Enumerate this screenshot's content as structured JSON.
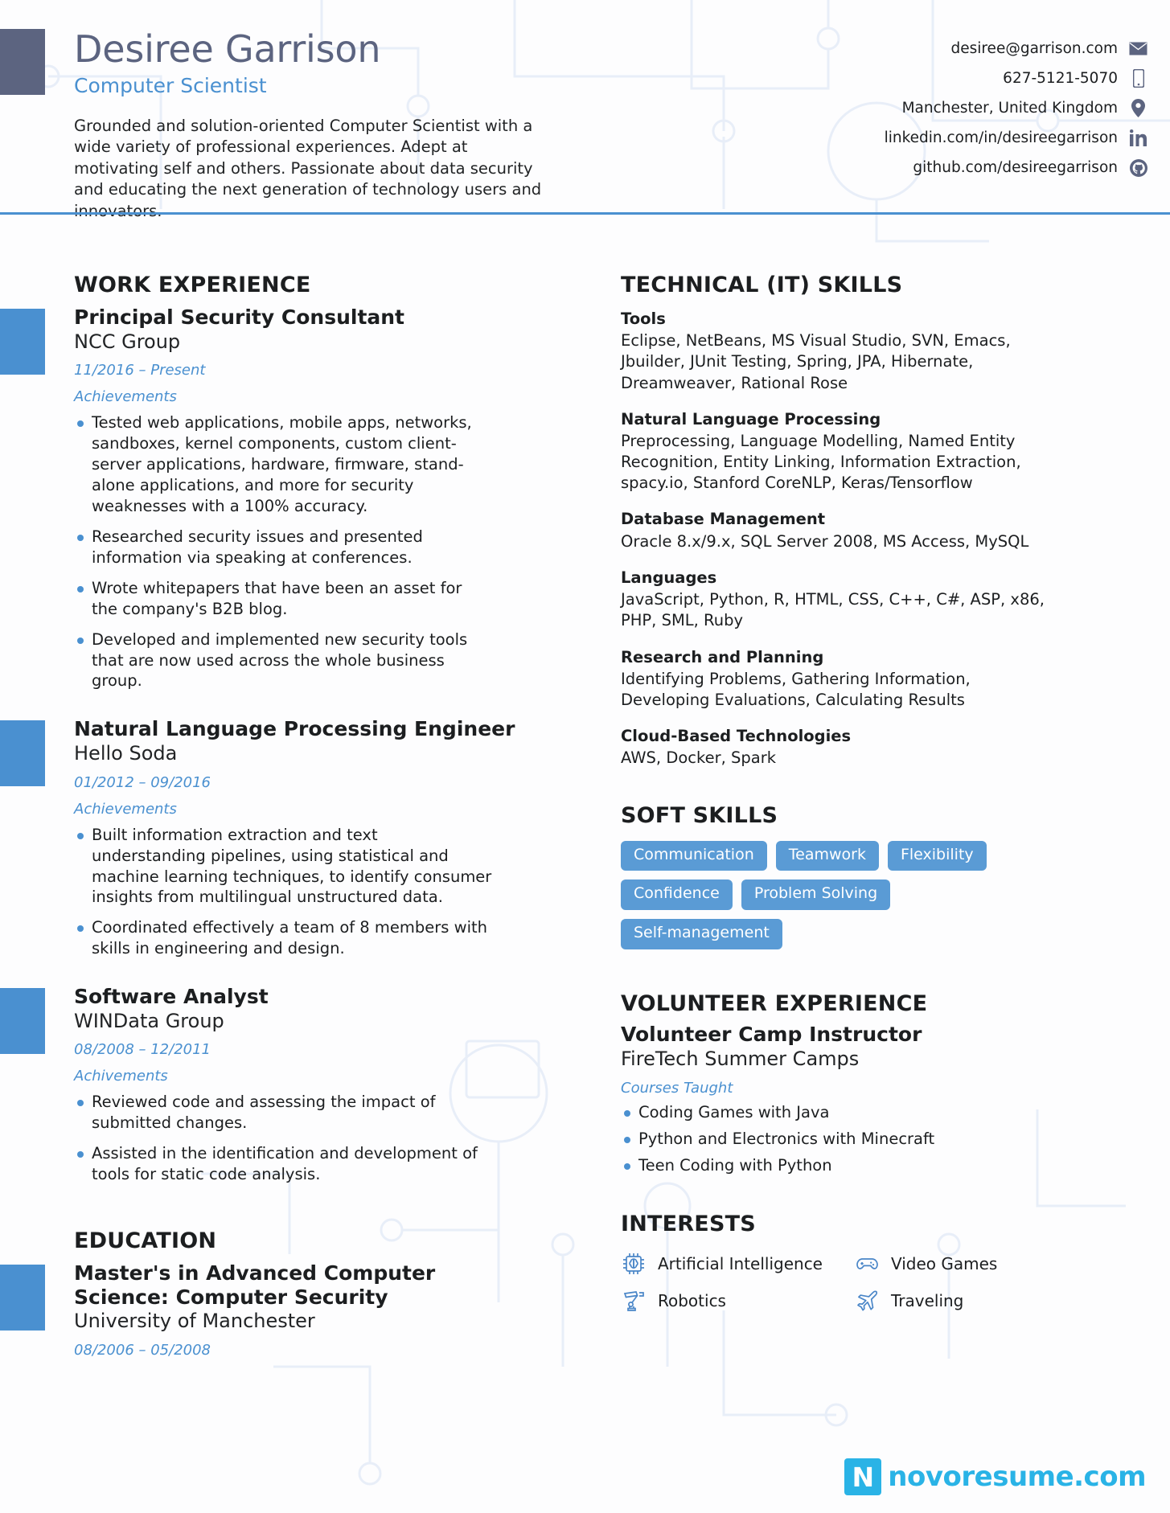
{
  "header": {
    "name": "Desiree Garrison",
    "title": "Computer Scientist",
    "summary": "Grounded and solution-oriented Computer Scientist with a wide variety of professional experiences. Adept at motivating self and others. Passionate about data security and educating the next generation of technology users and innovators.",
    "contacts": [
      {
        "text": "desiree@garrison.com",
        "icon": "envelope-icon"
      },
      {
        "text": "627-5121-5070",
        "icon": "mobile-phone-icon"
      },
      {
        "text": "Manchester, United Kingdom",
        "icon": "location-pin-icon"
      },
      {
        "text": "linkedin.com/in/desireegarrison",
        "icon": "linkedin-icon"
      },
      {
        "text": "github.com/desireegarrison",
        "icon": "github-icon"
      }
    ]
  },
  "work_experience": {
    "heading": "WORK EXPERIENCE",
    "jobs": [
      {
        "role": "Principal Security Consultant",
        "company": "NCC Group",
        "dates": "11/2016 – Present",
        "subhead": "Achievements",
        "bullets": [
          "Tested web applications, mobile apps, networks, sandboxes, kernel components, custom client-server applications, hardware, firmware, stand-alone applications, and more for security weaknesses with a 100% accuracy.",
          "Researched security issues and presented information via speaking at conferences.",
          "Wrote whitepapers that have been an asset for the company's B2B blog.",
          "Developed and implemented new security tools that are now used across the whole business group."
        ]
      },
      {
        "role": "Natural Language Processing Engineer",
        "company": "Hello Soda",
        "dates": "01/2012 – 09/2016",
        "subhead": "Achievements",
        "bullets": [
          "Built information extraction and text understanding pipelines, using statistical and machine learning techniques, to identify consumer insights from multilingual unstructured data.",
          "Coordinated effectively a team of 8 members with skills in engineering and design."
        ]
      },
      {
        "role": "Software Analyst",
        "company": "WINData Group",
        "dates": "08/2008 – 12/2011",
        "subhead": "Achivements",
        "bullets": [
          "Reviewed code and assessing the impact of submitted changes.",
          "Assisted in the identification and development of tools for static code analysis."
        ]
      }
    ]
  },
  "education": {
    "heading": "EDUCATION",
    "entries": [
      {
        "degree": "Master's in Advanced Computer Science: Computer Security",
        "school": "University of Manchester",
        "dates": "08/2006 – 05/2008"
      }
    ]
  },
  "technical_skills": {
    "heading": "TECHNICAL (IT) SKILLS",
    "groups": [
      {
        "label": "Tools",
        "value": "Eclipse, NetBeans, MS Visual Studio, SVN, Emacs, Jbuilder, JUnit Testing, Spring, JPA, Hibernate, Dreamweaver, Rational Rose"
      },
      {
        "label": "Natural Language Processing",
        "value": "Preprocessing, Language Modelling, Named Entity Recognition, Entity Linking, Information Extraction, spacy.io, Stanford CoreNLP, Keras/Tensorflow"
      },
      {
        "label": "Database Management",
        "value": "Oracle 8.x/9.x, SQL Server 2008, MS Access, MySQL"
      },
      {
        "label": "Languages",
        "value": "JavaScript, Python, R, HTML, CSS, C++, C#, ASP, x86, PHP, SML, Ruby"
      },
      {
        "label": "Research and Planning",
        "value": "Identifying Problems, Gathering Information, Developing Evaluations, Calculating Results"
      },
      {
        "label": "Cloud-Based Technologies",
        "value": "AWS, Docker, Spark"
      }
    ]
  },
  "soft_skills": {
    "heading": "SOFT SKILLS",
    "chips": [
      "Communication",
      "Teamwork",
      "Flexibility",
      "Confidence",
      "Problem Solving",
      "Self-management"
    ]
  },
  "volunteer": {
    "heading": "VOLUNTEER EXPERIENCE",
    "role": "Volunteer Camp Instructor",
    "organization": "FireTech Summer Camps",
    "subhead": "Courses Taught",
    "courses": [
      "Coding Games with Java",
      "Python and Electronics with Minecraft",
      "Teen Coding with Python"
    ]
  },
  "interests": {
    "heading": "INTERESTS",
    "items": [
      {
        "label": "Artificial Intelligence",
        "icon": "ai-chip-icon"
      },
      {
        "label": "Video Games",
        "icon": "gamepad-icon"
      },
      {
        "label": "Robotics",
        "icon": "robot-arm-icon"
      },
      {
        "label": "Traveling",
        "icon": "airplane-icon"
      }
    ]
  },
  "footer": {
    "logo_mark": "N",
    "logo_text": "novoresume.com"
  },
  "colors": {
    "accent_blue": "#4a90d0",
    "name_slate": "#5c6480",
    "chip_blue": "#5a9bd5",
    "logo_cyan": "#2ab3e6"
  }
}
